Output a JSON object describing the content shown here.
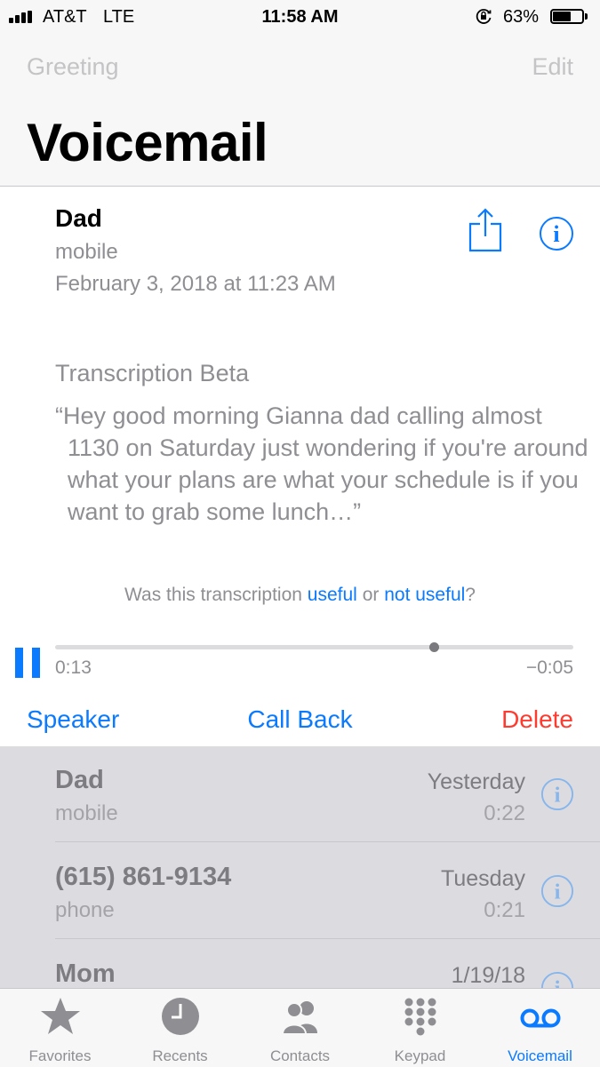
{
  "status_bar": {
    "carrier": "AT&T",
    "network": "LTE",
    "time": "11:58 AM",
    "battery": "63%",
    "battery_level": 0.63
  },
  "nav": {
    "left": "Greeting",
    "right": "Edit",
    "title": "Voicemail"
  },
  "detail": {
    "caller": "Dad",
    "type": "mobile",
    "date": "February 3, 2018 at 11:23 AM",
    "transcription_label": "Transcription Beta",
    "transcription_text": "“Hey good morning Gianna dad calling almost 1130 on Saturday just wondering if you're around what your plans are what your schedule is if you want to grab some lunch…”",
    "feedback_prefix": "Was this transcription",
    "feedback_useful": "useful",
    "feedback_or": "or",
    "feedback_not_useful": "not useful",
    "feedback_suffix": "?"
  },
  "player": {
    "elapsed": "0:13",
    "remaining": "−0:05",
    "progress": 0.73
  },
  "actions": {
    "speaker": "Speaker",
    "call_back": "Call Back",
    "delete": "Delete"
  },
  "list": [
    {
      "name": "Dad",
      "sub": "mobile",
      "day": "Yesterday",
      "duration": "0:22"
    },
    {
      "name": "(615) 861-9134",
      "sub": "phone",
      "day": "Tuesday",
      "duration": "0:21"
    },
    {
      "name": "Mom",
      "sub": "",
      "day": "1/19/18",
      "duration": ""
    }
  ],
  "tabs": [
    {
      "label": "Favorites",
      "icon": "star-icon"
    },
    {
      "label": "Recents",
      "icon": "clock-icon"
    },
    {
      "label": "Contacts",
      "icon": "contacts-icon"
    },
    {
      "label": "Keypad",
      "icon": "keypad-icon"
    },
    {
      "label": "Voicemail",
      "icon": "voicemail-icon",
      "active": true
    }
  ],
  "colors": {
    "accent": "#0a7aff",
    "destructive": "#ff3b30",
    "secondary_text": "#8e8e93"
  }
}
